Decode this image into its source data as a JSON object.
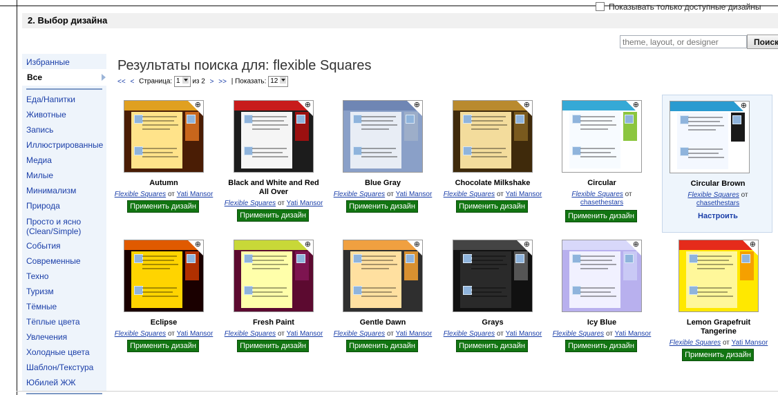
{
  "step_title": "2. Выбор дизайна",
  "available_only_label": "Показывать только доступные дизайны",
  "search": {
    "placeholder": "theme, layout, or designer",
    "button": "Поиск"
  },
  "sidebar": {
    "favorites": "Избранные",
    "all": "Все",
    "items": [
      "Еда/Напитки",
      "Животные",
      "Запись",
      "Иллюстрированные",
      "Медиа",
      "Милые",
      "Минимализм",
      "Природа",
      "Просто и ясно\n(Clean/Simple)",
      "События",
      "Современные",
      "Техно",
      "Туризм",
      "Тёмные",
      "Тёплые цвета",
      "Увлечения",
      "Холодные цвета",
      "Шаблон/Текстура",
      "Юбилей ЖЖ"
    ]
  },
  "results_title": "Результаты поиска для: flexible Squares",
  "pager": {
    "first": "<<",
    "prev": "<",
    "page_label": "Страница:",
    "page_value": "1",
    "of_text": "из 2",
    "next": ">",
    "last": ">>",
    "separator": "|",
    "show_label": "Показать:",
    "show_value": "12"
  },
  "common": {
    "apply_label": "Применить дизайн",
    "by_word": "от",
    "customize_label": "Настроить"
  },
  "themes": [
    {
      "name": "Autumn",
      "template": "Flexible Squares",
      "designer": "Yati Mansor",
      "selected": false,
      "colors": {
        "bg": "#4a1d05",
        "band": "#e0a020",
        "main": "#ffe38a",
        "side": "#c8661c"
      }
    },
    {
      "name": "Black and White and Red All Over",
      "template": "Flexible Squares",
      "designer": "Yati Mansor",
      "selected": false,
      "colors": {
        "bg": "#1c1c1c",
        "band": "#c81b1b",
        "main": "#f5f5f5",
        "side": "#9b1010"
      }
    },
    {
      "name": "Blue Gray",
      "template": "Flexible Squares",
      "designer": "Yati Mansor",
      "selected": false,
      "colors": {
        "bg": "#8aa0c8",
        "band": "#6f86b4",
        "main": "#e8edf5",
        "side": "#9daec9"
      }
    },
    {
      "name": "Chocolate Milkshake",
      "template": "Flexible Squares",
      "designer": "Yati Mansor",
      "selected": false,
      "colors": {
        "bg": "#3f2a0b",
        "band": "#b98a2e",
        "main": "#f3dc9c",
        "side": "#7a5a1e"
      }
    },
    {
      "name": "Circular",
      "template": "Flexible Squares",
      "designer": "chasethestars",
      "selected": false,
      "colors": {
        "bg": "#ffffff",
        "band": "#35a9d6",
        "main": "#f7fbff",
        "side": "#8cc63f"
      }
    },
    {
      "name": "Circular Brown",
      "template": "Flexible Squares",
      "designer": "chasethestars",
      "selected": true,
      "colors": {
        "bg": "#ffffff",
        "band": "#2a9bd0",
        "main": "#f4f8ff",
        "side": "#1a1a1a"
      }
    },
    {
      "name": "Eclipse",
      "template": "Flexible Squares",
      "designer": "Yati Mansor",
      "selected": false,
      "colors": {
        "bg": "#1a0000",
        "band": "#e05a00",
        "main": "#ffd400",
        "side": "#b03000"
      }
    },
    {
      "name": "Fresh Paint",
      "template": "Flexible Squares",
      "designer": "Yati Mansor",
      "selected": false,
      "colors": {
        "bg": "#5c0a30",
        "band": "#c8d838",
        "main": "#ffffaa",
        "side": "#7d1450"
      }
    },
    {
      "name": "Gentle Dawn",
      "template": "Flexible Squares",
      "designer": "Yati Mansor",
      "selected": false,
      "colors": {
        "bg": "#2f2f2f",
        "band": "#f0a040",
        "main": "#ffe0a0",
        "side": "#d79030"
      }
    },
    {
      "name": "Grays",
      "template": "Flexible Squares",
      "designer": "Yati Mansor",
      "selected": false,
      "colors": {
        "bg": "#111111",
        "band": "#444444",
        "main": "#2a2a2a",
        "side": "#555555"
      }
    },
    {
      "name": "Icy Blue",
      "template": "Flexible Squares",
      "designer": "Yati Mansor",
      "selected": false,
      "colors": {
        "bg": "#b8b0ee",
        "band": "#d8d8fa",
        "main": "#f1f1ff",
        "side": "#c9c9f5"
      }
    },
    {
      "name": "Lemon Grapefruit Tangerine",
      "template": "Flexible Squares",
      "designer": "Yati Mansor",
      "selected": false,
      "colors": {
        "bg": "#ffe800",
        "band": "#e52b1b",
        "main": "#fff79a",
        "side": "#f5a000"
      }
    }
  ]
}
